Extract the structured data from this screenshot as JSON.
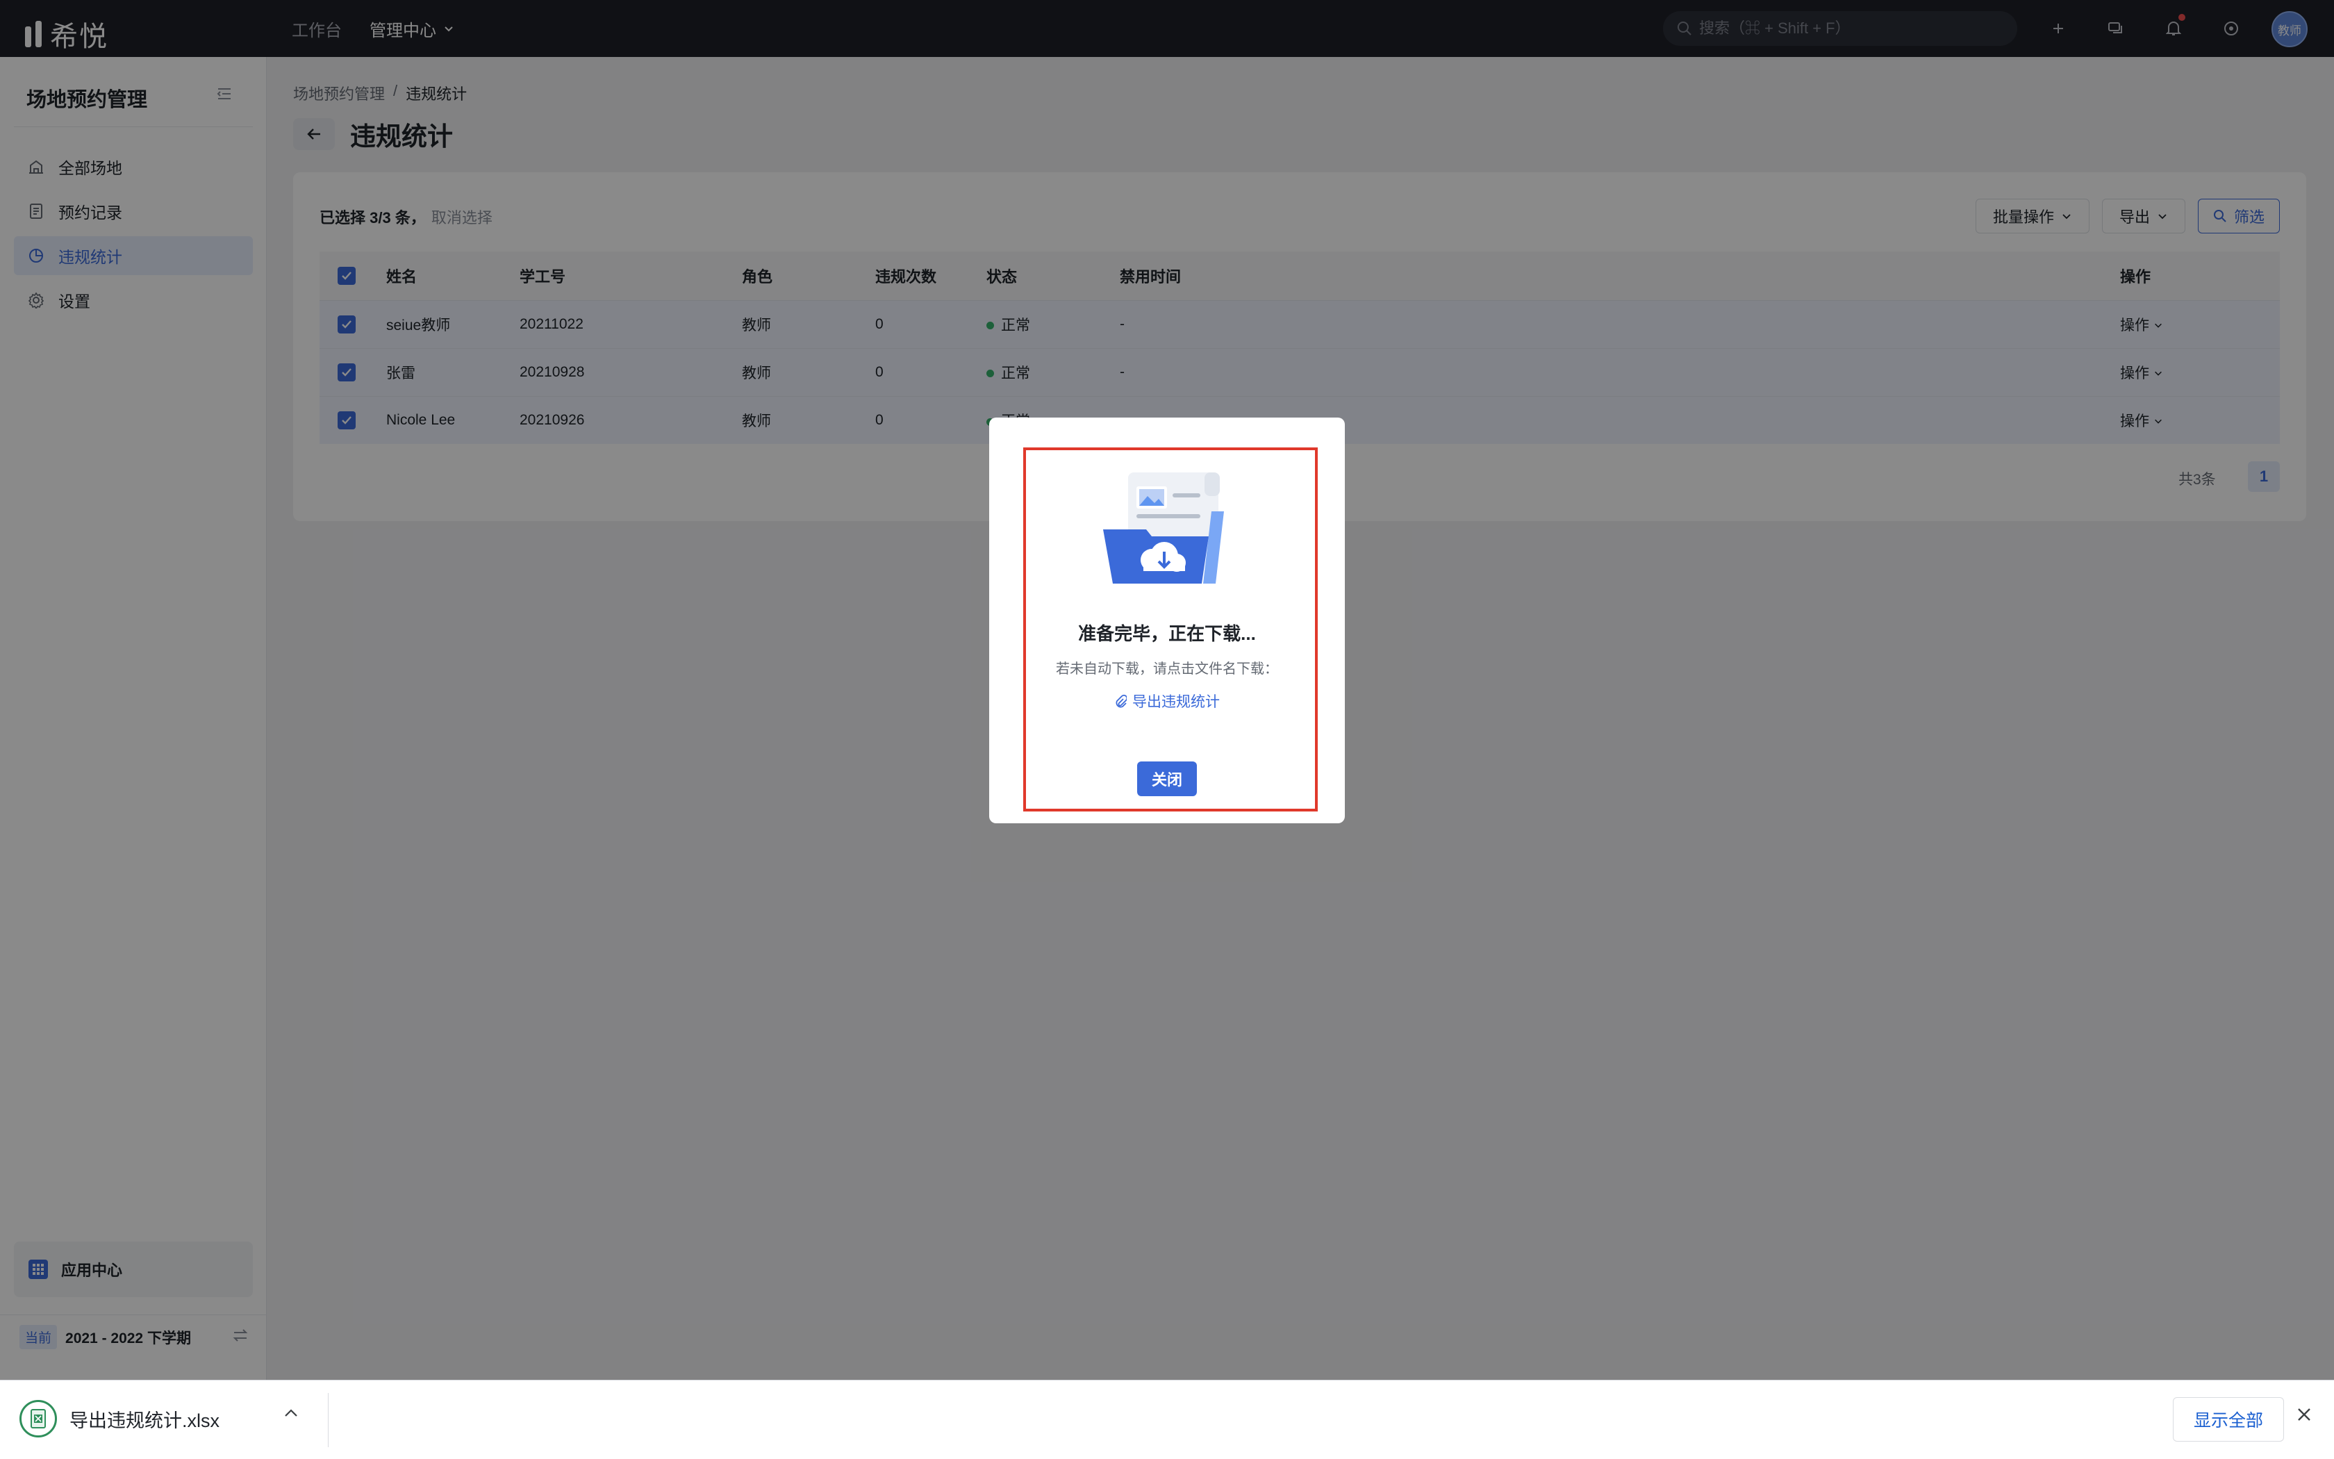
{
  "app": {
    "name": "希悦"
  },
  "topnav": {
    "items": [
      {
        "label": "工作台"
      },
      {
        "label": "管理中心"
      }
    ]
  },
  "search": {
    "placeholder": "搜索（⌘ + Shift + F）"
  },
  "user": {
    "avatar_text": "教师"
  },
  "sidebar": {
    "title": "场地预约管理",
    "items": [
      {
        "label": "全部场地",
        "icon": "building-icon"
      },
      {
        "label": "预约记录",
        "icon": "document-icon"
      },
      {
        "label": "违规统计",
        "icon": "chart-icon",
        "active": true
      },
      {
        "label": "设置",
        "icon": "gear-icon"
      }
    ],
    "app_center": "应用中心",
    "semester_badge": "当前",
    "semester": "2021 - 2022 下学期"
  },
  "breadcrumb": {
    "parent": "场地预约管理",
    "separator": "/",
    "current": "违规统计"
  },
  "page": {
    "title": "违规统计"
  },
  "toolbar": {
    "selection_text": "已选择 3/3 条，",
    "cancel_selection": "取消选择",
    "batch_label": "批量操作",
    "export_label": "导出",
    "filter_label": "筛选"
  },
  "table": {
    "columns": [
      "姓名",
      "学工号",
      "角色",
      "违规次数",
      "状态",
      "禁用时间",
      "操作"
    ],
    "rows": [
      {
        "name": "seiue教师",
        "id": "20211022",
        "role": "教师",
        "count": "0",
        "status": "正常",
        "ban": "-",
        "op": "操作"
      },
      {
        "name": "张雷",
        "id": "20210928",
        "role": "教师",
        "count": "0",
        "status": "正常",
        "ban": "-",
        "op": "操作"
      },
      {
        "name": "Nicole Lee",
        "id": "20210926",
        "role": "教师",
        "count": "0",
        "status": "正常",
        "ban": "-",
        "op": "操作"
      }
    ],
    "total": "共3条",
    "page": "1"
  },
  "modal": {
    "title": "准备完毕，正在下载...",
    "description": "若未自动下载，请点击文件名下载：",
    "file_link": "导出违规统计",
    "close_label": "关闭"
  },
  "download_bar": {
    "file_name": "导出违规统计.xlsx",
    "show_all": "显示全部"
  },
  "colors": {
    "accent": "#3b6ad9",
    "topbar": "#1e2028",
    "status_ok": "#37b26c",
    "highlight": "#e0392b"
  }
}
